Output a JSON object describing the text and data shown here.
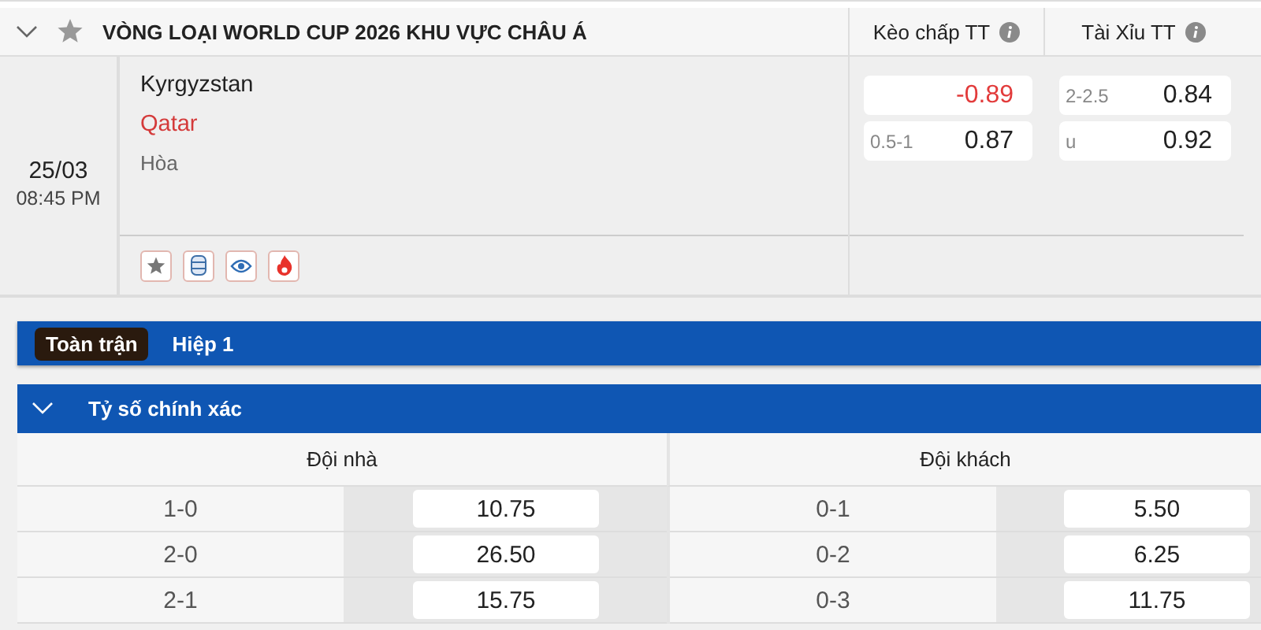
{
  "league": {
    "title": "VÒNG LOẠI WORLD CUP 2026 KHU VỰC CHÂU Á",
    "expanded": true
  },
  "odds_columns": [
    "Kèo chấp TT",
    "Tài Xỉu TT"
  ],
  "match": {
    "date": "25/03",
    "time": "08:45 PM",
    "teams": [
      {
        "name": "Kyrgyzstan",
        "highlighted": false
      },
      {
        "name": "Qatar",
        "highlighted": true
      }
    ],
    "draw": "Hòa",
    "markets": [
      {
        "rows": [
          {
            "line": "",
            "value": "-0.89",
            "negative": true
          },
          {
            "line": "0.5-1",
            "value": "0.87",
            "negative": false
          }
        ]
      },
      {
        "rows": [
          {
            "line": "2-2.5",
            "value": "0.84",
            "negative": false
          },
          {
            "line": "u",
            "value": "0.92",
            "negative": false
          }
        ]
      }
    ]
  },
  "tabs": [
    {
      "label": "Toàn trận",
      "selected": true
    },
    {
      "label": "Hiệp 1",
      "selected": false
    }
  ],
  "section": {
    "title": "Tỷ số chính xác",
    "expanded": true
  },
  "table": {
    "columns": [
      "Đội nhà",
      "Đội khách"
    ],
    "rows": [
      {
        "home_score": "1-0",
        "home_odds": "10.75",
        "away_score": "0-1",
        "away_odds": "5.50"
      },
      {
        "home_score": "2-0",
        "home_odds": "26.50",
        "away_score": "0-2",
        "away_odds": "6.25"
      },
      {
        "home_score": "2-1",
        "home_odds": "15.75",
        "away_score": "0-3",
        "away_odds": "11.75"
      }
    ]
  }
}
